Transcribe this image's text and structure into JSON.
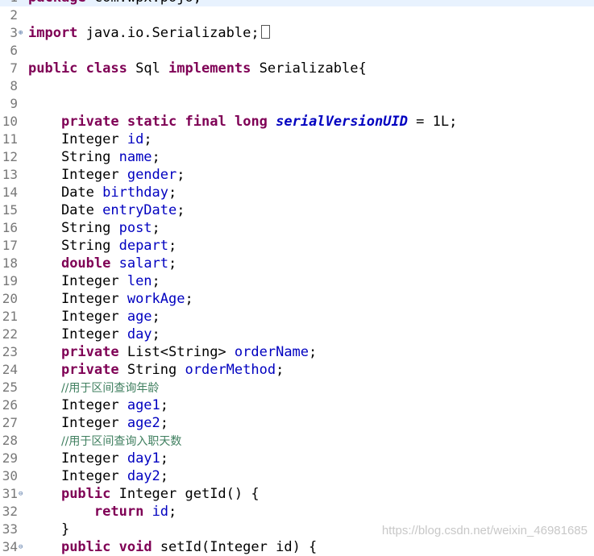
{
  "editor": {
    "lines": [
      {
        "n": "1",
        "t": [
          [
            "kw",
            "package"
          ],
          [
            "p",
            " com.wpx.pojo;"
          ]
        ]
      },
      {
        "n": "2",
        "t": []
      },
      {
        "n": "3",
        "fold": "⊕",
        "t": [
          [
            "kw",
            "import"
          ],
          [
            "p",
            " java.io.Serializable;"
          ]
        ],
        "box": true
      },
      {
        "n": "6",
        "t": []
      },
      {
        "n": "7",
        "t": [
          [
            "kw",
            "public"
          ],
          [
            "p",
            " "
          ],
          [
            "kw",
            "class"
          ],
          [
            "p",
            " Sql "
          ],
          [
            "kw",
            "implements"
          ],
          [
            "p",
            " Serializable{"
          ]
        ]
      },
      {
        "n": "8",
        "t": []
      },
      {
        "n": "9",
        "t": []
      },
      {
        "n": "10",
        "t": [
          [
            "p",
            "    "
          ],
          [
            "kw",
            "private"
          ],
          [
            "p",
            " "
          ],
          [
            "kw",
            "static"
          ],
          [
            "p",
            " "
          ],
          [
            "kw",
            "final"
          ],
          [
            "p",
            " "
          ],
          [
            "kw",
            "long"
          ],
          [
            "p",
            " "
          ],
          [
            "static",
            "serialVersionUID"
          ],
          [
            "p",
            " = 1L;"
          ]
        ]
      },
      {
        "n": "11",
        "t": [
          [
            "p",
            "    Integer "
          ],
          [
            "fld",
            "id"
          ],
          [
            "p",
            ";"
          ]
        ]
      },
      {
        "n": "12",
        "t": [
          [
            "p",
            "    String "
          ],
          [
            "fld",
            "name"
          ],
          [
            "p",
            ";"
          ]
        ]
      },
      {
        "n": "13",
        "t": [
          [
            "p",
            "    Integer "
          ],
          [
            "fld",
            "gender"
          ],
          [
            "p",
            ";"
          ]
        ]
      },
      {
        "n": "14",
        "t": [
          [
            "p",
            "    Date "
          ],
          [
            "fld",
            "birthday"
          ],
          [
            "p",
            ";"
          ]
        ]
      },
      {
        "n": "15",
        "t": [
          [
            "p",
            "    Date "
          ],
          [
            "fld",
            "entryDate"
          ],
          [
            "p",
            ";"
          ]
        ]
      },
      {
        "n": "16",
        "t": [
          [
            "p",
            "    String "
          ],
          [
            "fld",
            "post"
          ],
          [
            "p",
            ";"
          ]
        ]
      },
      {
        "n": "17",
        "t": [
          [
            "p",
            "    String "
          ],
          [
            "fld",
            "depart"
          ],
          [
            "p",
            ";"
          ]
        ]
      },
      {
        "n": "18",
        "t": [
          [
            "p",
            "    "
          ],
          [
            "kw",
            "double"
          ],
          [
            "p",
            " "
          ],
          [
            "fld",
            "salart"
          ],
          [
            "p",
            ";"
          ]
        ]
      },
      {
        "n": "19",
        "t": [
          [
            "p",
            "    Integer "
          ],
          [
            "fld",
            "len"
          ],
          [
            "p",
            ";"
          ]
        ]
      },
      {
        "n": "20",
        "t": [
          [
            "p",
            "    Integer "
          ],
          [
            "fld",
            "workAge"
          ],
          [
            "p",
            ";"
          ]
        ]
      },
      {
        "n": "21",
        "t": [
          [
            "p",
            "    Integer "
          ],
          [
            "fld",
            "age"
          ],
          [
            "p",
            ";"
          ]
        ]
      },
      {
        "n": "22",
        "t": [
          [
            "p",
            "    Integer "
          ],
          [
            "fld",
            "day"
          ],
          [
            "p",
            ";"
          ]
        ]
      },
      {
        "n": "23",
        "t": [
          [
            "p",
            "    "
          ],
          [
            "kw",
            "private"
          ],
          [
            "p",
            " List<String> "
          ],
          [
            "fld",
            "orderName"
          ],
          [
            "p",
            ";"
          ]
        ]
      },
      {
        "n": "24",
        "t": [
          [
            "p",
            "    "
          ],
          [
            "kw",
            "private"
          ],
          [
            "p",
            " String "
          ],
          [
            "fld",
            "orderMethod"
          ],
          [
            "p",
            ";"
          ]
        ]
      },
      {
        "n": "25",
        "t": [
          [
            "p",
            "    "
          ],
          [
            "cmt",
            "//用于区间查询年龄"
          ]
        ]
      },
      {
        "n": "26",
        "t": [
          [
            "p",
            "    Integer "
          ],
          [
            "fld",
            "age1"
          ],
          [
            "p",
            ";"
          ]
        ]
      },
      {
        "n": "27",
        "t": [
          [
            "p",
            "    Integer "
          ],
          [
            "fld",
            "age2"
          ],
          [
            "p",
            ";"
          ]
        ]
      },
      {
        "n": "28",
        "t": [
          [
            "p",
            "    "
          ],
          [
            "cmt",
            "//用于区间查询入职天数"
          ]
        ]
      },
      {
        "n": "29",
        "t": [
          [
            "p",
            "    Integer "
          ],
          [
            "fld",
            "day1"
          ],
          [
            "p",
            ";"
          ]
        ]
      },
      {
        "n": "30",
        "t": [
          [
            "p",
            "    Integer "
          ],
          [
            "fld",
            "day2"
          ],
          [
            "p",
            ";"
          ]
        ]
      },
      {
        "n": "31",
        "fold": "⊖",
        "t": [
          [
            "p",
            "    "
          ],
          [
            "kw",
            "public"
          ],
          [
            "p",
            " Integer getId() {"
          ]
        ]
      },
      {
        "n": "32",
        "t": [
          [
            "p",
            "        "
          ],
          [
            "kw",
            "return"
          ],
          [
            "p",
            " "
          ],
          [
            "fld",
            "id"
          ],
          [
            "p",
            ";"
          ]
        ]
      },
      {
        "n": "33",
        "t": [
          [
            "p",
            "    }"
          ]
        ]
      },
      {
        "n": "34",
        "fold": "⊖",
        "t": [
          [
            "p",
            "    "
          ],
          [
            "kw",
            "public"
          ],
          [
            "p",
            " "
          ],
          [
            "kw",
            "void"
          ],
          [
            "p",
            " setId(Integer id) {"
          ]
        ]
      }
    ]
  },
  "watermark": "https://blog.csdn.net/weixin_46981685"
}
